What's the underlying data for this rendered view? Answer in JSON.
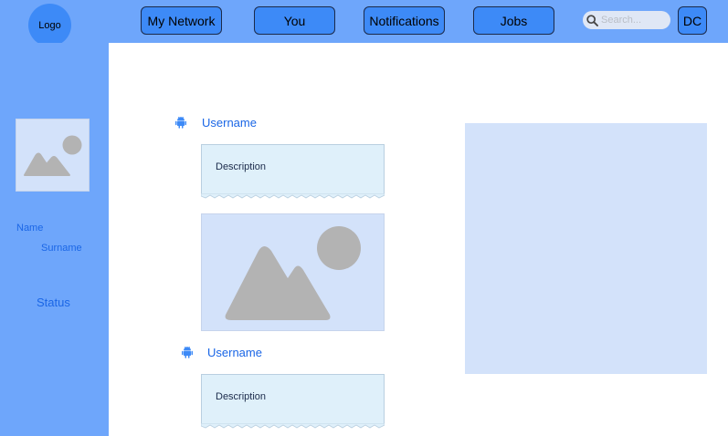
{
  "header": {
    "logo": "Logo",
    "nav": [
      {
        "label": "My Network"
      },
      {
        "label": "You"
      },
      {
        "label": "Notifications"
      },
      {
        "label": "Jobs"
      }
    ],
    "search_placeholder": "Search...",
    "user_initials": "DC"
  },
  "sidebar": {
    "name": "Name",
    "surname": "Surname",
    "status": "Status"
  },
  "feed": {
    "posts": [
      {
        "username": "Username",
        "description": "Description"
      },
      {
        "username": "Username",
        "description": "Description"
      }
    ]
  },
  "colors": {
    "bar": "#6ea6fb",
    "button": "#3d8af7",
    "link_text": "#1a66e6",
    "placeholder_fill": "#d3e2fa",
    "description_fill": "#dff0fa"
  },
  "icons": [
    "search-icon",
    "android-icon",
    "image-placeholder-icon"
  ]
}
